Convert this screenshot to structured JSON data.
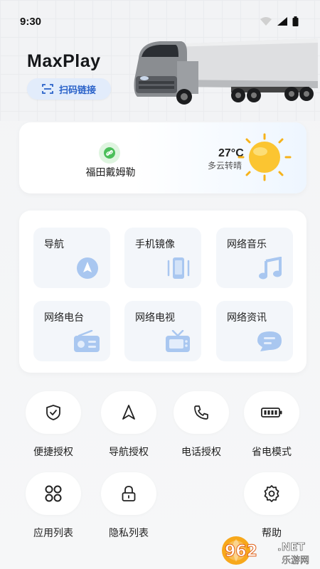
{
  "status": {
    "time": "9:30"
  },
  "header": {
    "title": "MaxPlay",
    "scan_label": "扫码链接"
  },
  "vehicle": {
    "name": "福田戴姆勒"
  },
  "weather": {
    "temperature": "27°C",
    "description": "多云转晴"
  },
  "apps": [
    {
      "label": "导航",
      "icon": "navigation-arrow-icon"
    },
    {
      "label": "手机镜像",
      "icon": "phone-mirror-icon"
    },
    {
      "label": "网络音乐",
      "icon": "music-note-icon"
    },
    {
      "label": "网络电台",
      "icon": "radio-icon"
    },
    {
      "label": "网络电视",
      "icon": "tv-icon"
    },
    {
      "label": "网络资讯",
      "icon": "news-chat-icon"
    }
  ],
  "permissions": [
    {
      "label": "便捷授权",
      "icon": "shield-check-icon"
    },
    {
      "label": "导航授权",
      "icon": "navigation-arrow-icon"
    },
    {
      "label": "电话授权",
      "icon": "phone-icon"
    },
    {
      "label": "省电模式",
      "icon": "battery-icon"
    },
    {
      "label": "应用列表",
      "icon": "app-grid-icon"
    },
    {
      "label": "隐私列表",
      "icon": "lock-icon"
    },
    {
      "label": "帮助",
      "icon": "gear-icon"
    }
  ],
  "watermark": {
    "text_top": "962",
    "text_mid": ".NET",
    "text_bottom": "乐游网"
  },
  "colors": {
    "accent": "#2a62c9",
    "icon_fill": "#a9c7f0",
    "tile_bg": "#f3f6fa"
  }
}
